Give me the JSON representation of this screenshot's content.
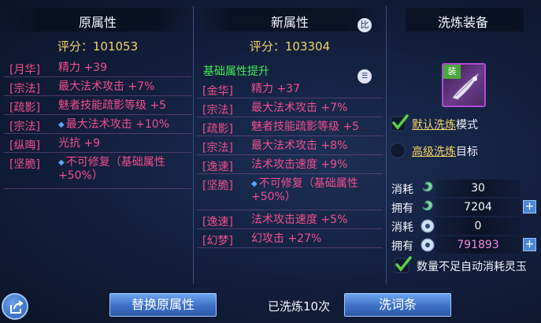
{
  "original": {
    "title": "原属性",
    "score": "评分：101053",
    "rows": [
      {
        "tag": "[月华]",
        "value": "精力 +39",
        "dot": false
      },
      {
        "tag": "[宗法]",
        "value": "最大法术攻击 +7%",
        "dot": false
      },
      {
        "tag": "[疏影]",
        "value": "魅者技能疏影等级 +5",
        "dot": false
      },
      {
        "tag": "[宗法]",
        "value": "最大法术攻击 +10%",
        "dot": true
      },
      {
        "tag": "[纵晦]",
        "value": "光抗 +9",
        "dot": false
      },
      {
        "tag": "[坚脆]",
        "value": "不可修复（基础属性+50%）",
        "dot": true
      }
    ]
  },
  "new_attr": {
    "title": "新属性",
    "score": "评分：103304",
    "compare_icon": "比",
    "section_title": "基础属性提升",
    "rows": [
      {
        "tag": "[金华]",
        "value": "精力 +37",
        "dot": false
      },
      {
        "tag": "[宗法]",
        "value": "最大法术攻击 +7%",
        "dot": false
      },
      {
        "tag": "[疏影]",
        "value": "魅者技能疏影等级 +5",
        "dot": false
      },
      {
        "tag": "[宗法]",
        "value": "最大法术攻击 +8%",
        "dot": false
      },
      {
        "tag": "[逸速]",
        "value": "法术攻击速度 +9%",
        "dot": false
      },
      {
        "tag": "[坚脆]",
        "value": "不可修复（基础属性+50%）",
        "dot": true
      },
      {
        "tag": "[逸速]",
        "value": "法术攻击速度 +5%",
        "dot": false
      },
      {
        "tag": "[幻梦]",
        "value": "幻攻击 +27%",
        "dot": false
      }
    ]
  },
  "refine": {
    "title": "洗炼装备",
    "equip_badge": "装",
    "default_link": "默认洗炼",
    "default_suffix": "模式",
    "advanced_link": "高级洗炼",
    "advanced_suffix": "目标",
    "cost1_label": "消耗",
    "cost1_value": "30",
    "own1_label": "拥有",
    "own1_value": "7204",
    "cost2_label": "消耗",
    "cost2_value": "0",
    "own2_label": "拥有",
    "own2_value": "791893",
    "plus": "+",
    "auto_text": "数量不足自动消耗灵玉"
  },
  "bottom": {
    "replace_button": "替换原属性",
    "wash_count": "已洗炼10次",
    "wash_button": "洗词条"
  },
  "colors": {
    "accent_gold": "#f4d36a",
    "attr_pink": "#ef4f8c",
    "section_green": "#44ea5a",
    "button_blue": "#3d70c6"
  }
}
